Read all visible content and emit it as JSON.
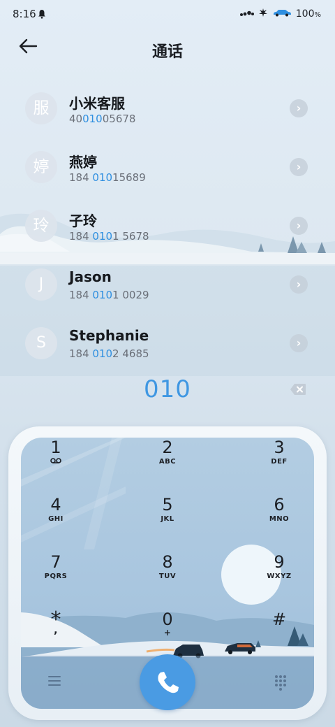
{
  "status_bar": {
    "time": "8:16",
    "battery": "100",
    "battery_unit": "%",
    "icons": [
      "notification-bell-icon",
      "signal-icon",
      "activity-icon",
      "car-icon",
      "battery-text"
    ]
  },
  "header": {
    "title": "通话",
    "back_icon": "arrow-left-icon"
  },
  "contacts": [
    {
      "avatar": "服",
      "name": "小米客服",
      "num_pre": "40",
      "num_hl": "010",
      "num_post": "05678"
    },
    {
      "avatar": "婷",
      "name": "燕婷",
      "num_pre": "184 ",
      "num_hl": "010",
      "num_post": "15689"
    },
    {
      "avatar": "玲",
      "name": "子玲",
      "num_pre": "184 ",
      "num_hl": "010",
      "num_post": "1 5678"
    },
    {
      "avatar": "J",
      "name": "Jason",
      "num_pre": "184 ",
      "num_hl": "010",
      "num_post": "1 0029"
    },
    {
      "avatar": "S",
      "name": "Stephanie",
      "num_pre": "184 ",
      "num_hl": "010",
      "num_post": "2 4685"
    }
  ],
  "dialer": {
    "input": "010",
    "backspace_icon": "backspace-icon",
    "keys": [
      {
        "digit": "1",
        "letters": ""
      },
      {
        "digit": "2",
        "letters": "ABC"
      },
      {
        "digit": "3",
        "letters": "DEF"
      },
      {
        "digit": "4",
        "letters": "GHI"
      },
      {
        "digit": "5",
        "letters": "JKL"
      },
      {
        "digit": "6",
        "letters": "MNO"
      },
      {
        "digit": "7",
        "letters": "PQRS"
      },
      {
        "digit": "8",
        "letters": "TUV"
      },
      {
        "digit": "9",
        "letters": "WXYZ"
      },
      {
        "digit": "*",
        "letters": ","
      },
      {
        "digit": "0",
        "letters": "+"
      },
      {
        "digit": "#",
        "letters": ""
      }
    ],
    "menu_icon": "menu-icon",
    "call_icon": "phone-icon",
    "keypad_toggle_icon": "dialpad-icon"
  }
}
